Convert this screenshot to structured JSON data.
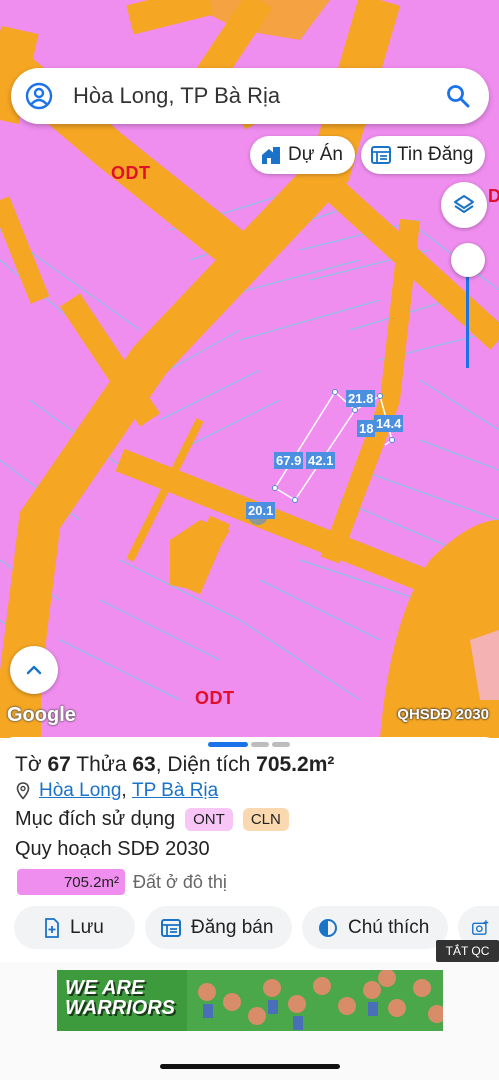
{
  "search": {
    "query": "Hòa Long, TP Bà Rịa"
  },
  "chips": {
    "projects_label": "Dự Án",
    "listings_label": "Tin Đăng"
  },
  "map": {
    "zone_labels": [
      "ODT",
      "ODT",
      "D"
    ],
    "dimension_labels": [
      "21.8",
      "18",
      "14.4",
      "67.9",
      "42.1",
      "20.1"
    ],
    "google_logo": "Google",
    "layer_name": "QHSDĐ 2030",
    "colors": {
      "residential_zone": "#f08ef0",
      "road": "#f5a623",
      "parcel_lines": "#6ad3e0",
      "selection": "#4a8fe0"
    }
  },
  "parcel": {
    "sheet_label": "Tờ",
    "sheet_no": "67",
    "plot_label": "Thửa",
    "plot_no": "63",
    "area_label": "Diện tích",
    "area_value": "705.2m²",
    "ward": "Hòa Long",
    "city": "TP Bà Rịa",
    "purpose_label": "Mục đích sử dụng",
    "purpose_tags": [
      "ONT",
      "CLN"
    ],
    "plan_title": "Quy hoạch SDĐ 2030",
    "plan_area": "705.2m²",
    "plan_desc": "Đất ở đô thị"
  },
  "actions": {
    "save": "Lưu",
    "post": "Đăng bán",
    "legend": "Chú thích"
  },
  "ad": {
    "close_label": "TẮT QC",
    "banner_line1": "WE ARE",
    "banner_line2": "WARRIORS"
  }
}
